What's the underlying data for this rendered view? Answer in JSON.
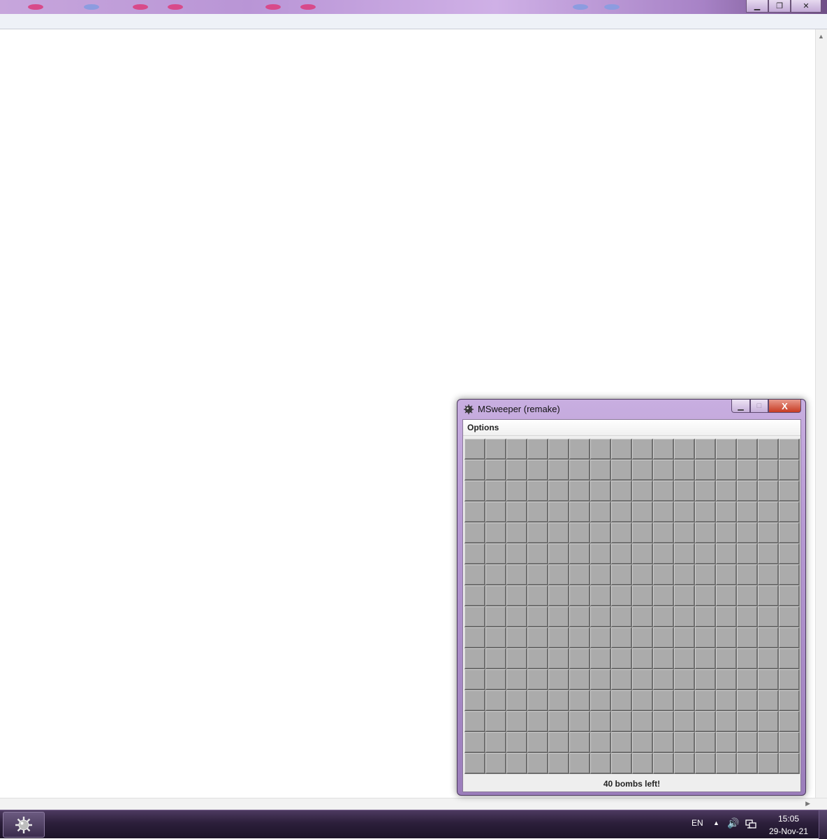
{
  "background_window": {
    "controls": {
      "minimize": "▁",
      "restore": "❐",
      "close": "✕"
    }
  },
  "msweeper": {
    "title": "MSweeper (remake)",
    "controls": {
      "minimize": "▁",
      "maximize": "□",
      "close": "X"
    },
    "menu": {
      "options_label": "Options"
    },
    "grid": {
      "rows": 16,
      "columns": 16
    },
    "status": "40 bombs left!"
  },
  "taskbar": {
    "language": "EN",
    "tray_arrow": "▲",
    "volume_icon": "🔊",
    "time": "15:05",
    "date": "29-Nov-21"
  },
  "colors": {
    "window_frame": "#b79ad4",
    "cell_face": "#ababab",
    "close_button": "#c73b23",
    "taskbar": "#2c1f3b"
  }
}
